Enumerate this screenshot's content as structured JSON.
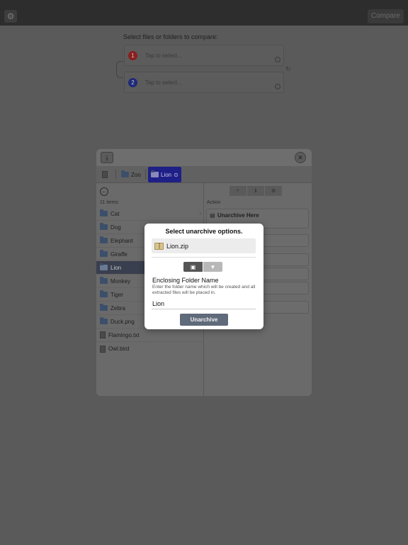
{
  "topbar": {
    "settings_icon": "gear-icon",
    "compare_label": "Compare"
  },
  "compare": {
    "prompt": "Select files or folders to compare:",
    "slots": [
      {
        "number": "1",
        "placeholder": "Tap to select...",
        "color": "#8a1f1f"
      },
      {
        "number": "2",
        "placeholder": "Tap to select...",
        "color": "#1f2a7a"
      }
    ]
  },
  "browser": {
    "breadcrumbs": [
      {
        "label": "Zoo"
      },
      {
        "label": "Lion"
      }
    ],
    "item_count": "11 items",
    "items": [
      {
        "name": "Cat",
        "kind": "folder",
        "arrow": "›"
      },
      {
        "name": "Dog",
        "kind": "folder"
      },
      {
        "name": "Elephant",
        "kind": "folder"
      },
      {
        "name": "Giraffe",
        "kind": "folder"
      },
      {
        "name": "Lion",
        "kind": "folder"
      },
      {
        "name": "Monkey",
        "kind": "folder"
      },
      {
        "name": "Tiger",
        "kind": "folder"
      },
      {
        "name": "Zebra",
        "kind": "folder"
      },
      {
        "name": "Duck.png",
        "kind": "image"
      },
      {
        "name": "Flamingo.txt",
        "kind": "text"
      },
      {
        "name": "Owl.bird",
        "kind": "file"
      }
    ],
    "selected_item": "Lion",
    "action_label": "Action",
    "action_first": "Unarchive Here"
  },
  "modal": {
    "title": "Select unarchive options.",
    "archive_name": "Lion.zip",
    "field_label": "Enclosing Folder Name",
    "field_help": "Enter the folder name which will be created and all extracted files will be placed in.",
    "field_value": "Lion",
    "button_label": "Unarchive"
  },
  "colors": {
    "selected_crumb": "#1f1f88",
    "button": "#5f6a7a"
  }
}
